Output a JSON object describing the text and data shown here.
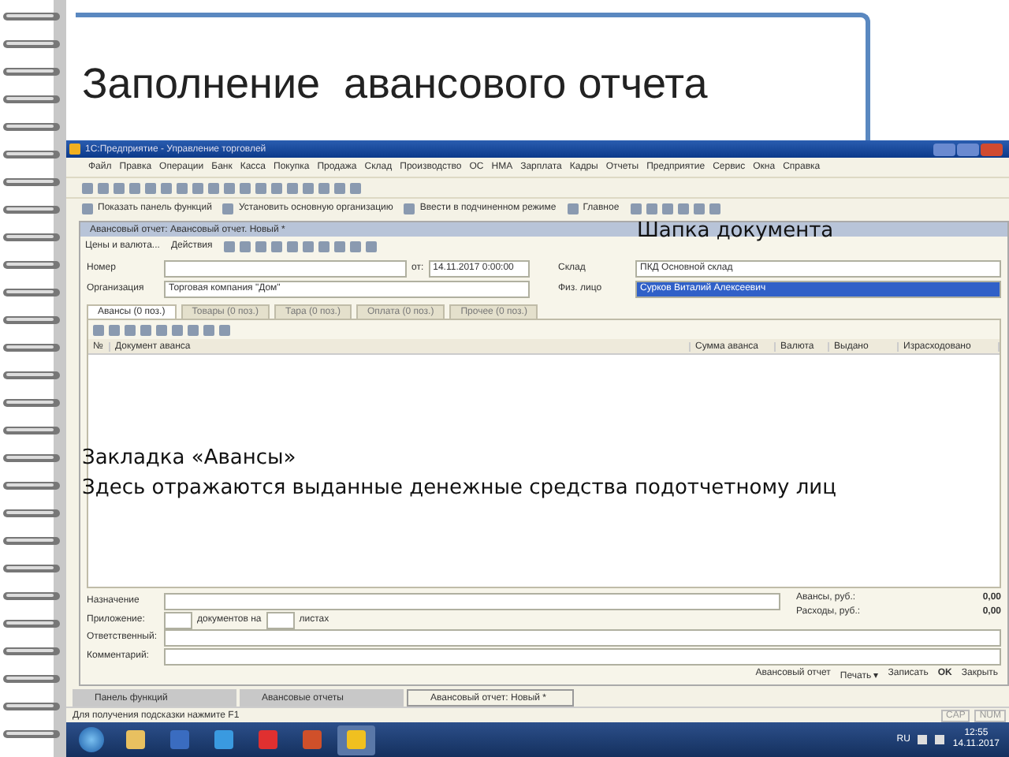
{
  "slide": {
    "title": "Заполнение  авансового отчета",
    "header_note": "Шапка документа",
    "tab_note": [
      "Закладка «Авансы»",
      "Здесь отражаются выданные денежные средства подотчетному лиц"
    ]
  },
  "app": {
    "window_title": "1С:Предприятие - Управление торговлей",
    "menu": [
      "Файл",
      "Правка",
      "Операции",
      "Банк",
      "Касса",
      "Покупка",
      "Продажа",
      "Склад",
      "Производство",
      "ОС",
      "НМА",
      "Зарплата",
      "Кадры",
      "Отчеты",
      "Предприятие",
      "Сервис",
      "Окна",
      "Справка"
    ],
    "quick_buttons": [
      "Показать панель функций",
      "Установить основную организацию",
      "Ввести в подчиненном режиме",
      "Главное"
    ],
    "form": {
      "title": "Авансовый отчет: Авансовый отчет. Новый *",
      "toolbar": [
        "Цены и валюта...",
        "Действия"
      ],
      "left_fields": [
        {
          "label": "Номер"
        },
        {
          "label": "Организация",
          "value": "Торговая компания \"Дом\""
        }
      ],
      "date_label": "от:",
      "date": "14.11.2017 0:00:00",
      "right_fields": [
        {
          "label": "Склад",
          "value": "ПКД Основной склад",
          "selected": false
        },
        {
          "label": "Физ. лицо",
          "value": "Сурков Виталий Алексеевич",
          "selected": true
        }
      ],
      "tabs": [
        {
          "label": "Авансы (0 поз.)",
          "selected": true
        },
        {
          "label": "Товары (0 поз.)",
          "selected": false
        },
        {
          "label": "Тара (0 поз.)",
          "selected": false
        },
        {
          "label": "Оплата (0 поз.)",
          "selected": false
        },
        {
          "label": "Прочее (0 поз.)",
          "selected": false
        }
      ],
      "columns": [
        "№",
        "Документ аванса",
        "Сумма аванса",
        "Валюта",
        "Выдано",
        "Израсходовано"
      ],
      "purpose_label": "Назначение",
      "attachment_label": "Приложение:",
      "attachment_mid": "документов на",
      "attachment_end": "листах",
      "responsible_label": "Ответственный:",
      "comment_label": "Комментарий:",
      "totals": [
        {
          "label": "Авансы, руб.:",
          "value": "0,00"
        },
        {
          "label": "Расходы, руб.:",
          "value": "0,00"
        }
      ],
      "buttons": [
        "Авансовый отчет",
        "Печать ▾",
        "Записать",
        "OK",
        "Закрыть"
      ]
    },
    "windows": [
      {
        "label": "Панель функций",
        "selected": false
      },
      {
        "label": "Авансовые отчеты",
        "selected": false
      },
      {
        "label": "Авансовый отчет: Новый *",
        "selected": true
      }
    ],
    "status": "Для получения подсказки нажмите F1",
    "indicators": [
      "CAP",
      "NUM"
    ]
  },
  "taskbar": {
    "language": "RU",
    "time": "12:55",
    "date": "14.11.2017"
  }
}
